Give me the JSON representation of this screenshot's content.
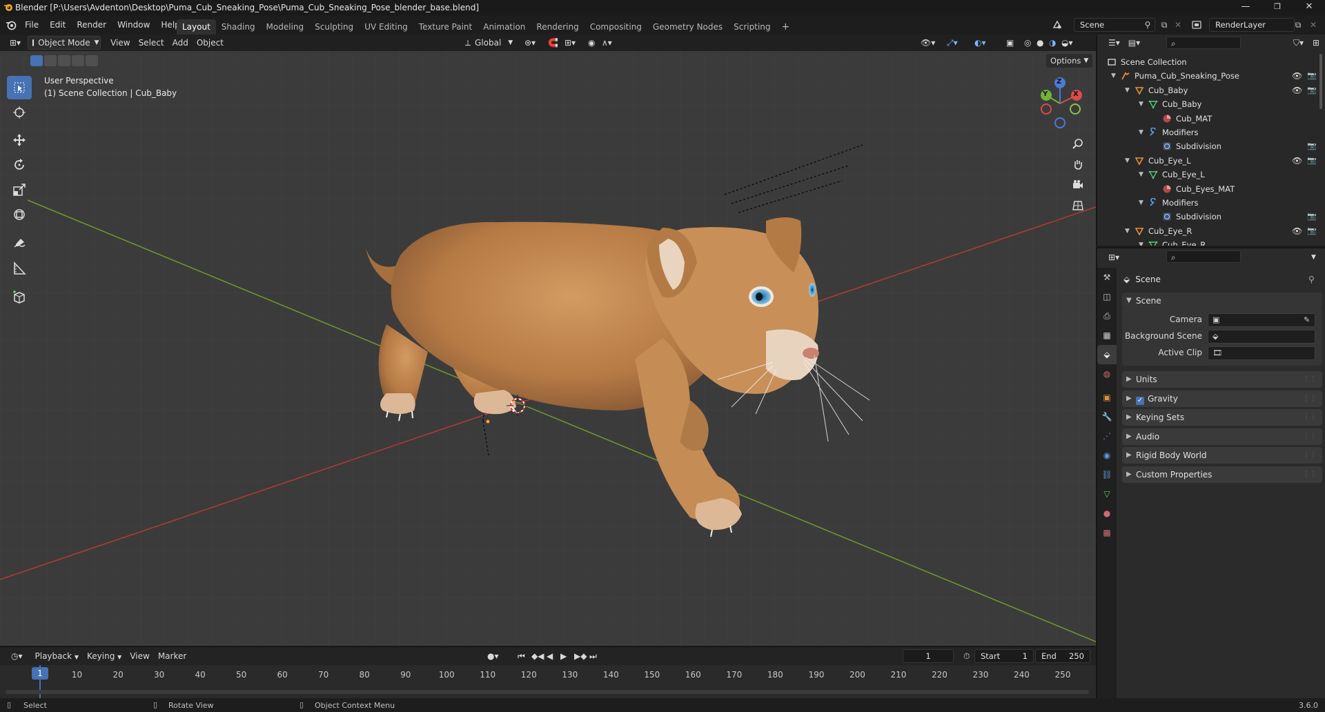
{
  "window": {
    "title": "Blender [P:\\Users\\Avdenton\\Desktop\\Puma_Cub_Sneaking_Pose\\Puma_Cub_Sneaking_Pose_blender_base.blend]",
    "controls": [
      "—",
      "❐",
      "✕"
    ]
  },
  "menu": [
    "File",
    "Edit",
    "Render",
    "Window",
    "Help"
  ],
  "workspaces": [
    {
      "label": "Layout",
      "active": true
    },
    {
      "label": "Shading"
    },
    {
      "label": "Modeling"
    },
    {
      "label": "Sculpting"
    },
    {
      "label": "UV Editing"
    },
    {
      "label": "Texture Paint"
    },
    {
      "label": "Animation"
    },
    {
      "label": "Rendering"
    },
    {
      "label": "Compositing"
    },
    {
      "label": "Geometry Nodes"
    },
    {
      "label": "Scripting"
    }
  ],
  "add_workspace": "+",
  "scene_field": "Scene",
  "renderlayer_field": "RenderLayer",
  "viewport_header": {
    "mode": "Object Mode",
    "menus": [
      "View",
      "Select",
      "Add",
      "Object"
    ],
    "transform": "Global",
    "options": "Options"
  },
  "viewport": {
    "perspective": "User Perspective",
    "collection": "(1) Scene Collection | Cub_Baby",
    "gizmo": {
      "z": "Z",
      "y": "Y",
      "x": "X"
    }
  },
  "outliner": {
    "rows": [
      {
        "label": "Scene Collection",
        "indent": 0,
        "icon": "collection"
      },
      {
        "label": "Puma_Cub_Sneaking_Pose",
        "indent": 1,
        "icon": "armature",
        "eye": true
      },
      {
        "label": "Cub_Baby",
        "indent": 2,
        "icon": "mesh-object",
        "eye": true
      },
      {
        "label": "Cub_Baby",
        "indent": 3,
        "icon": "mesh-data"
      },
      {
        "label": "Cub_MAT",
        "indent": 4,
        "icon": "material"
      },
      {
        "label": "Modifiers",
        "indent": 3,
        "icon": "wrench"
      },
      {
        "label": "Subdivision",
        "indent": 4,
        "icon": "modifier",
        "cam": true
      },
      {
        "label": "Cub_Eye_L",
        "indent": 2,
        "icon": "mesh-object",
        "eye": true
      },
      {
        "label": "Cub_Eye_L",
        "indent": 3,
        "icon": "mesh-data"
      },
      {
        "label": "Cub_Eyes_MAT",
        "indent": 4,
        "icon": "material"
      },
      {
        "label": "Modifiers",
        "indent": 3,
        "icon": "wrench"
      },
      {
        "label": "Subdivision",
        "indent": 4,
        "icon": "modifier",
        "cam": true
      },
      {
        "label": "Cub_Eye_R",
        "indent": 2,
        "icon": "mesh-object",
        "eye": true
      },
      {
        "label": "Cub_Eye_R",
        "indent": 3,
        "icon": "mesh-data"
      }
    ]
  },
  "properties": {
    "breadcrumb": "Scene",
    "section": "Scene",
    "fields": [
      {
        "label": "Camera"
      },
      {
        "label": "Background Scene"
      },
      {
        "label": "Active Clip"
      }
    ],
    "panels": [
      {
        "label": "Units"
      },
      {
        "label": "Gravity",
        "checkbox": true
      },
      {
        "label": "Keying Sets"
      },
      {
        "label": "Audio"
      },
      {
        "label": "Rigid Body World"
      },
      {
        "label": "Custom Properties"
      }
    ]
  },
  "timeline": {
    "menus": [
      "Playback",
      "Keying",
      "View",
      "Marker"
    ],
    "current_frame": "1",
    "start_label": "Start",
    "start": "1",
    "end_label": "End",
    "end": "250",
    "ticks": [
      "1",
      "10",
      "20",
      "30",
      "40",
      "50",
      "60",
      "70",
      "80",
      "90",
      "100",
      "110",
      "120",
      "130",
      "140",
      "150",
      "160",
      "170",
      "180",
      "190",
      "200",
      "210",
      "220",
      "230",
      "240",
      "250"
    ]
  },
  "status": {
    "select": "Select",
    "rotate": "Rotate View",
    "context": "Object Context Menu",
    "version": "3.6.0"
  }
}
